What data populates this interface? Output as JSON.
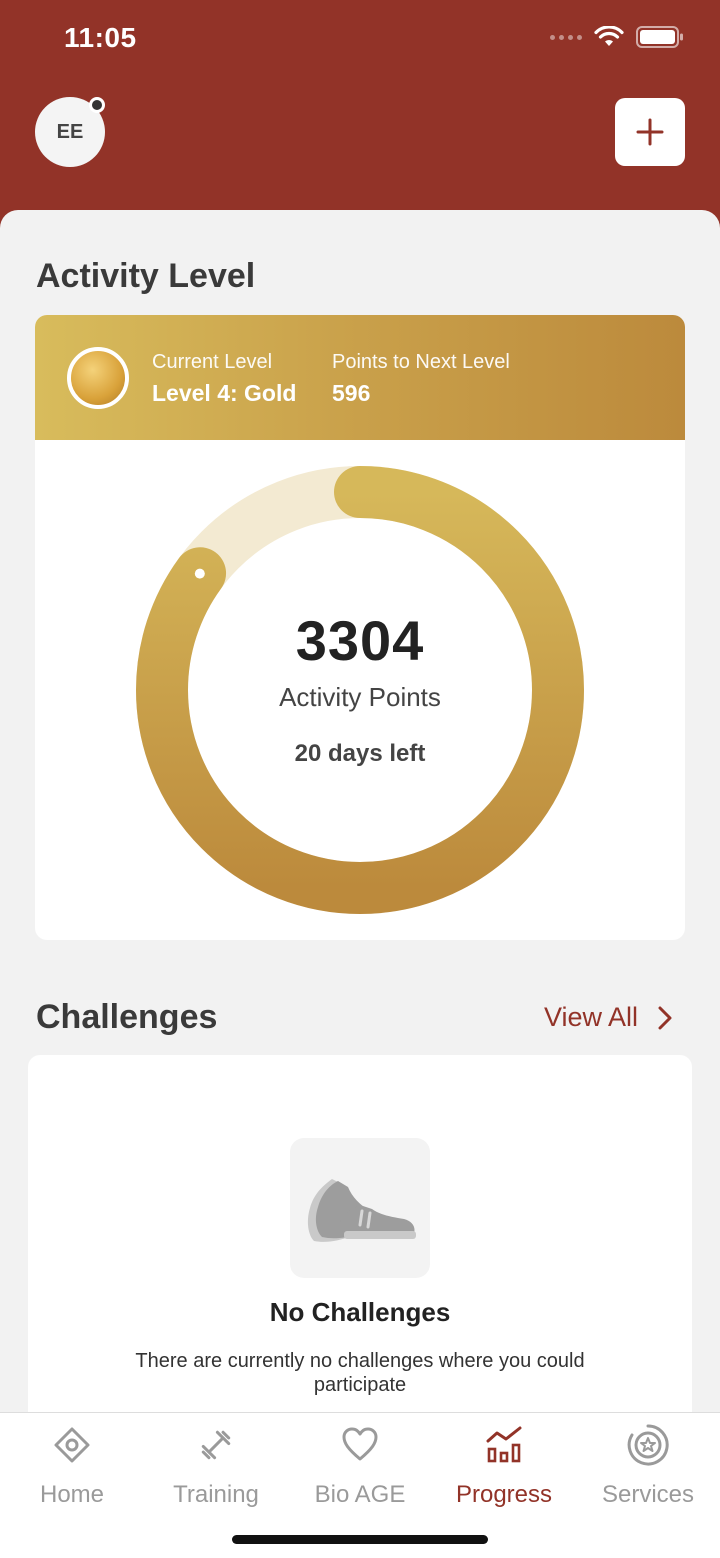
{
  "status_bar": {
    "time": "11:05"
  },
  "header": {
    "avatar_initials": "EE"
  },
  "activity": {
    "section_title": "Activity Level",
    "current_level_label": "Current Level",
    "current_level_value": "Level 4: Gold",
    "next_level_label": "Points to Next Level",
    "next_level_value": "596",
    "points": "3304",
    "points_label": "Activity Points",
    "days_left": "20 days left",
    "progress_fraction": 0.85
  },
  "challenges": {
    "section_title": "Challenges",
    "view_all": "View All",
    "empty_title": "No Challenges",
    "empty_desc": "There are currently no challenges where you could participate"
  },
  "tabs": [
    {
      "label": "Home",
      "icon": "home-icon",
      "active": false
    },
    {
      "label": "Training",
      "icon": "dumbbell-icon",
      "active": false
    },
    {
      "label": "Bio AGE",
      "icon": "heart-icon",
      "active": false
    },
    {
      "label": "Progress",
      "icon": "chart-icon",
      "active": true
    },
    {
      "label": "Services",
      "icon": "star-badge-icon",
      "active": false
    }
  ],
  "colors": {
    "brand": "#923328",
    "gold_light": "#d8bc5c",
    "gold_dark": "#bc8a3c",
    "ring_track": "#f3ead2"
  }
}
